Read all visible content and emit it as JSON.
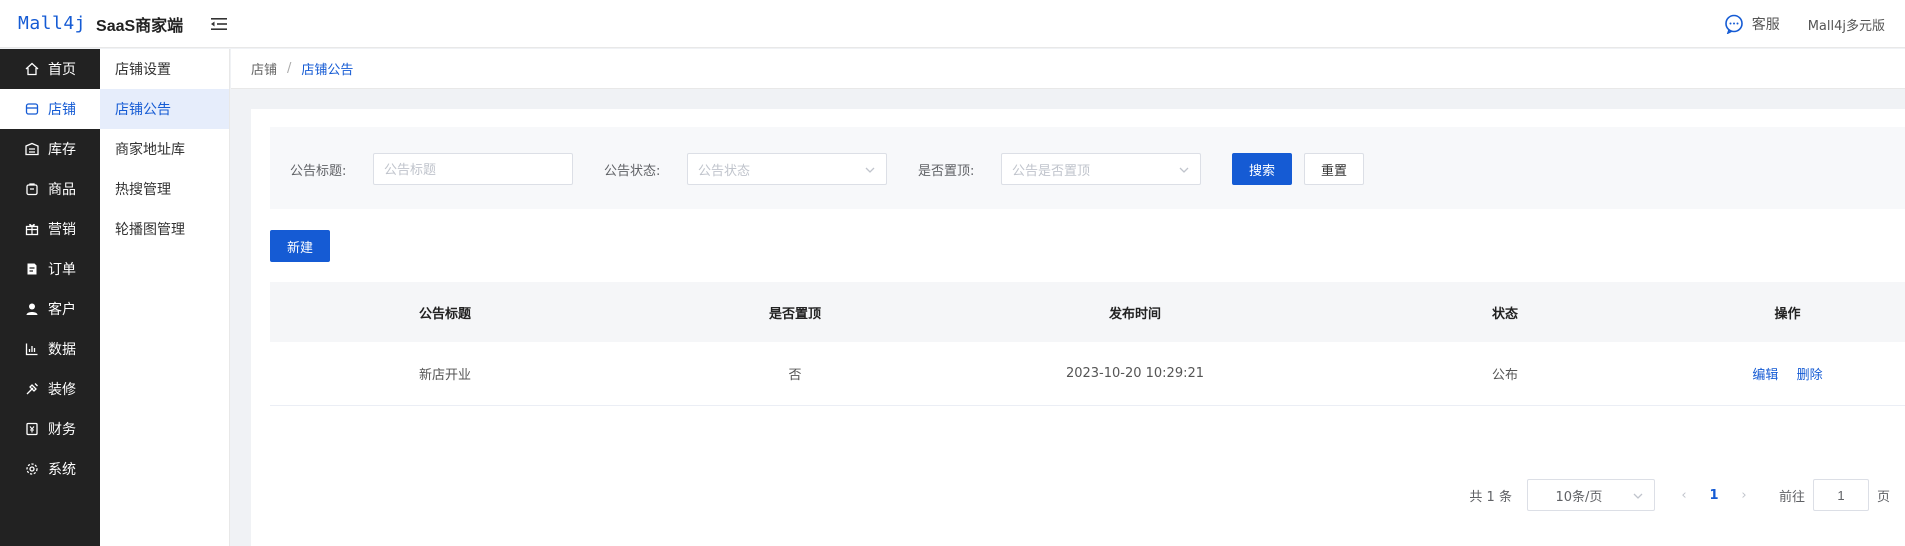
{
  "header": {
    "logo_mark": "Mall4j",
    "logo_text": "SaaS商家端",
    "customer_service": "客服",
    "version": "Mall4j多元版"
  },
  "sidebar": {
    "items": [
      {
        "label": "首页",
        "icon": "home-icon",
        "active": false
      },
      {
        "label": "店铺",
        "icon": "shop-icon",
        "active": true
      },
      {
        "label": "库存",
        "icon": "stock-icon",
        "active": false
      },
      {
        "label": "商品",
        "icon": "goods-icon",
        "active": false
      },
      {
        "label": "营销",
        "icon": "gift-icon",
        "active": false
      },
      {
        "label": "订单",
        "icon": "order-icon",
        "active": false
      },
      {
        "label": "客户",
        "icon": "user-icon",
        "active": false
      },
      {
        "label": "数据",
        "icon": "chart-icon",
        "active": false
      },
      {
        "label": "装修",
        "icon": "decorate-icon",
        "active": false
      },
      {
        "label": "财务",
        "icon": "finance-icon",
        "active": false
      },
      {
        "label": "系统",
        "icon": "gear-icon",
        "active": false
      }
    ]
  },
  "subnav": {
    "items": [
      {
        "label": "店铺设置",
        "active": false
      },
      {
        "label": "店铺公告",
        "active": true
      },
      {
        "label": "商家地址库",
        "active": false
      },
      {
        "label": "热搜管理",
        "active": false
      },
      {
        "label": "轮播图管理",
        "active": false
      }
    ]
  },
  "breadcrumb": {
    "parent": "店铺",
    "separator": "/",
    "current": "店铺公告"
  },
  "search": {
    "title_label": "公告标题:",
    "title_placeholder": "公告标题",
    "status_label": "公告状态:",
    "status_placeholder": "公告状态",
    "top_label": "是否置顶:",
    "top_placeholder": "公告是否置顶",
    "search_button": "搜索",
    "reset_button": "重置"
  },
  "actions": {
    "new_button": "新建"
  },
  "table": {
    "headers": [
      "公告标题",
      "是否置顶",
      "发布时间",
      "状态",
      "操作"
    ],
    "rows": [
      {
        "title": "新店开业",
        "is_top": "否",
        "time": "2023-10-20 10:29:21",
        "status": "公布",
        "edit": "编辑",
        "delete": "删除"
      }
    ]
  },
  "pagination": {
    "total": "共 1 条",
    "page_size": "10条/页",
    "prev": "‹",
    "current_page": "1",
    "next": "›",
    "goto_label": "前往",
    "goto_value": "1",
    "page_suffix": "页"
  },
  "colors": {
    "primary": "#155bd4",
    "sidebar_bg": "#222222",
    "active_sub_bg": "#e6edfb"
  }
}
